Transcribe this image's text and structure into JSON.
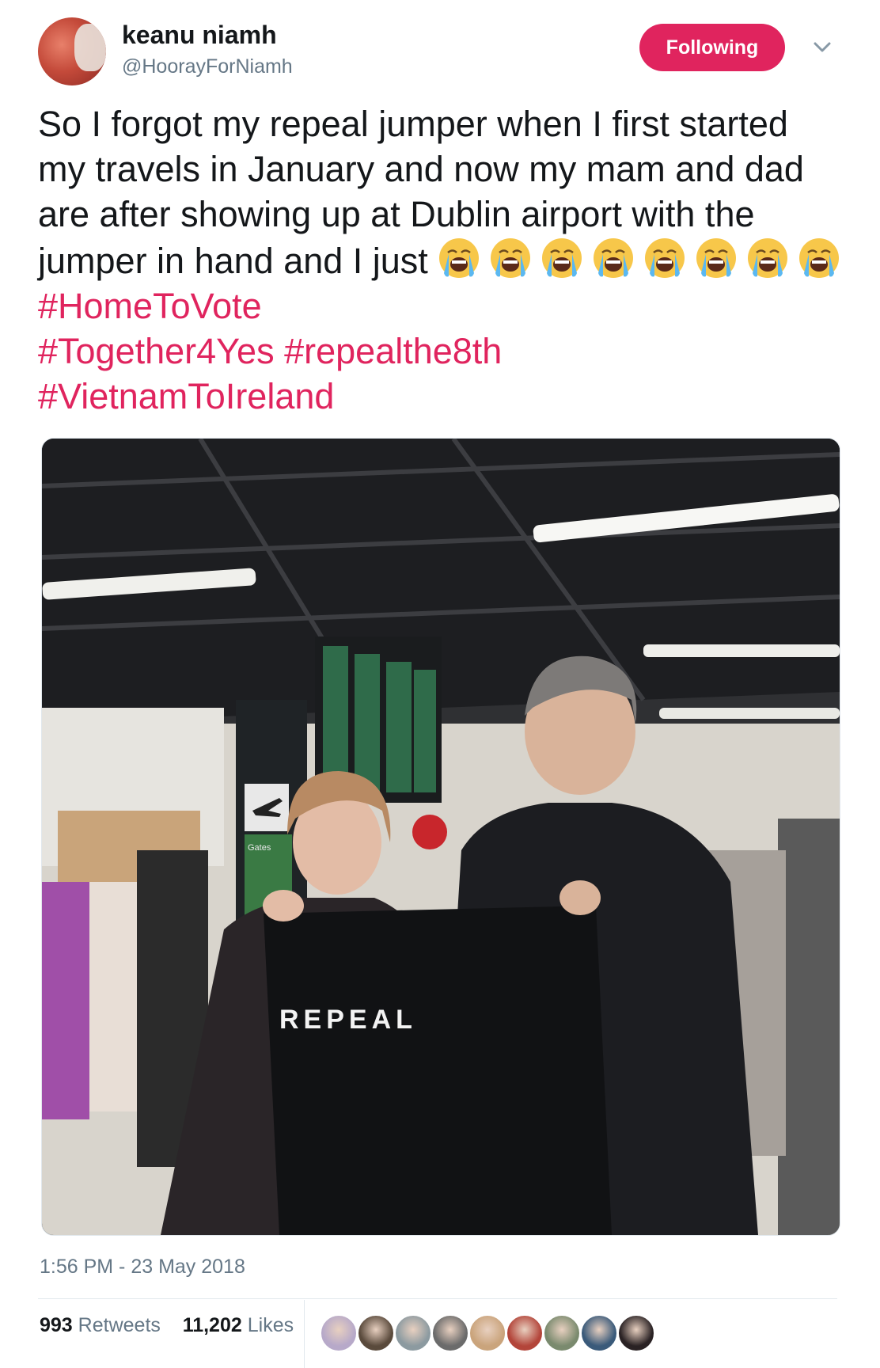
{
  "user": {
    "display_name": "keanu niamh",
    "handle": "@HoorayForNiamh",
    "follow_label": "Following"
  },
  "tweet": {
    "text_main": "So I forgot my repeal jumper when I first started my travels in January and now my mam and dad are after showing up at Dublin airport with the jumper in hand and I just ",
    "emoji_count": 8,
    "emoji_name": "loudly-crying-face-emoji",
    "hashtags": [
      "#HomeToVote",
      "#Together4Yes",
      "#repealthe8th",
      "#VietnamToIreland"
    ]
  },
  "photo": {
    "jumper_text": "REPEAL",
    "sign_text": "Geatai\nImeacht\nDepar\nGates"
  },
  "timestamp": "1:56 PM - 23 May 2018",
  "stats": {
    "retweets_count": "993",
    "retweets_label": "Retweets",
    "likes_count": "11,202",
    "likes_label": "Likes"
  },
  "colors": {
    "accent": "#e0245e",
    "muted": "#657786",
    "text": "#14171a"
  }
}
